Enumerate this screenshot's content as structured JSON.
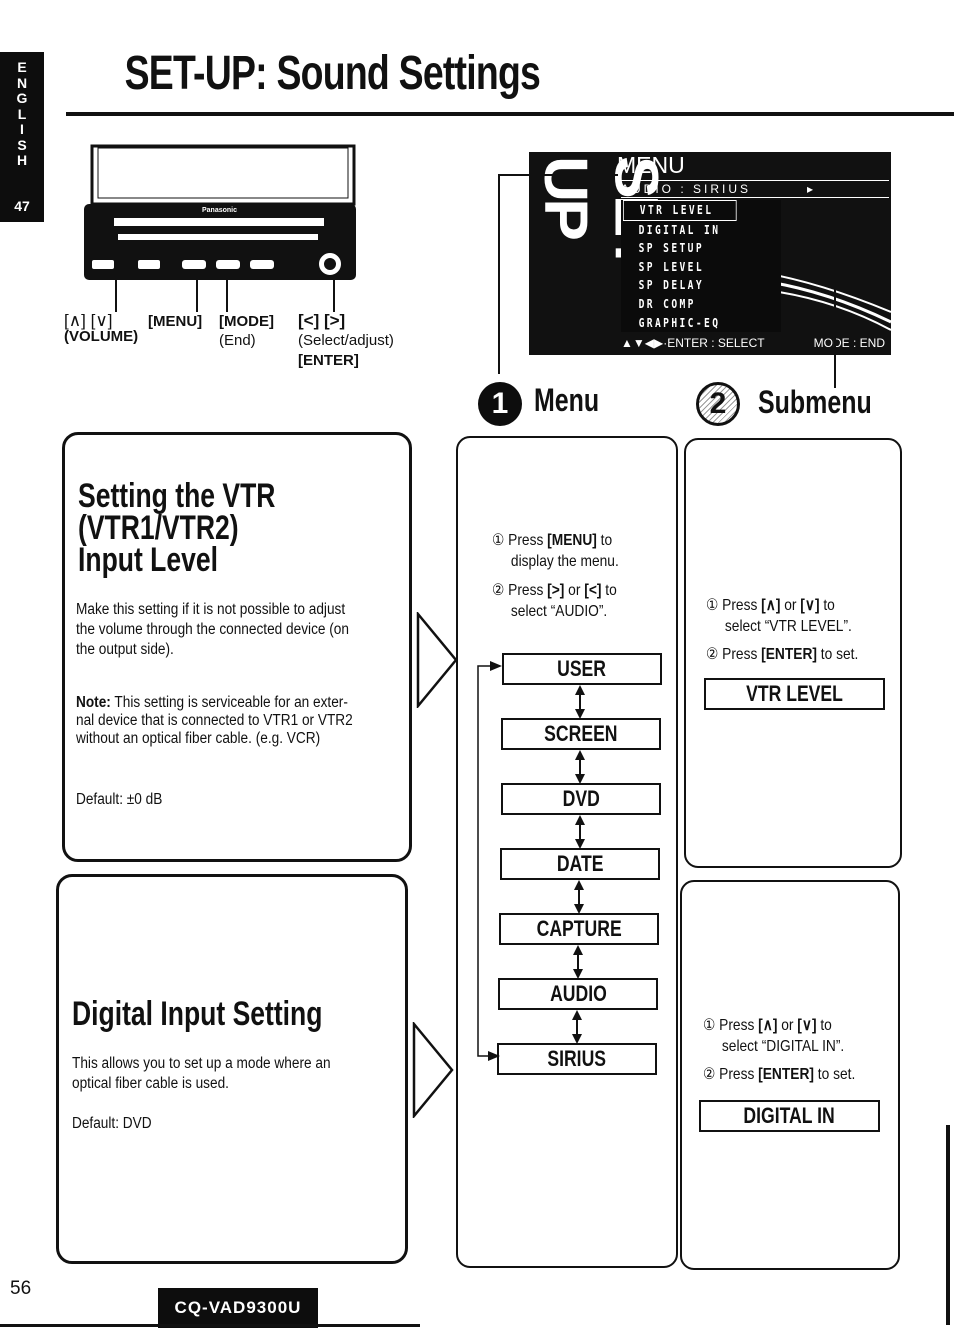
{
  "side_tab": {
    "letters": [
      "E",
      "N",
      "G",
      "L",
      "I",
      "S",
      "H"
    ],
    "chapter": "47"
  },
  "page_title": "SET-UP: Sound Settings",
  "device": {
    "brand": "Panasonic",
    "callouts": {
      "volume_keys": "[∧] [∨]",
      "volume_label": "(VOLUME)",
      "menu_key": "[MENU]",
      "mode_key": "[MODE]",
      "mode_label": "(End)",
      "select_keys": "[<] [>]",
      "select_label": "(Select/adjust)",
      "enter_key": "[ENTER]"
    }
  },
  "screen": {
    "side_text": "SET-UP",
    "title": "MENU",
    "breadcrumb": "AUDIO : SIRIUS",
    "breadcrumb_arrow": "▸",
    "items": [
      "VTR LEVEL",
      "DIGITAL IN",
      "SP SETUP",
      "SP LEVEL",
      "SP DELAY",
      "DR COMP",
      "GRAPHIC-EQ"
    ],
    "selected_index": 0,
    "footer_left": "▲▼◀▶·ENTER : SELECT",
    "footer_right": "MODE : END"
  },
  "sections": {
    "menu": {
      "number": "1",
      "label": "Menu"
    },
    "submenu": {
      "number": "2",
      "label": "Submenu"
    }
  },
  "vtr_setting": {
    "title_lines": [
      "Setting the VTR",
      "(VTR1/VTR2)",
      "Input Level"
    ],
    "description_lines": [
      "Make this setting if it is not possible to adjust",
      "the volume through the connected device (on",
      "the output side)."
    ],
    "note_label": "Note:",
    "note_lines": [
      " This setting is serviceable for an exter-",
      "nal device that is connected to VTR1 or VTR2",
      "without an optical fiber cable. (e.g. VCR)"
    ],
    "default": "Default: ±0 dB"
  },
  "digital_setting": {
    "title": "Digital Input Setting",
    "description_lines": [
      "This allows you to set up a mode where an",
      "optical fiber cable is used."
    ],
    "default": "Default: DVD"
  },
  "menu_steps": {
    "step1_num": "①",
    "step1_pre": " Press ",
    "step1_key": "[MENU]",
    "step1_post": " to",
    "step1_line2": "display the menu.",
    "step2_num": "②",
    "step2_pre": " Press ",
    "step2_key1": "[>]",
    "step2_mid": " or ",
    "step2_key2": "[<]",
    "step2_post": " to",
    "step2_line2": "select “AUDIO”."
  },
  "menu_chain": [
    "USER",
    "SCREEN",
    "DVD",
    "DATE",
    "CAPTURE",
    "AUDIO",
    "SIRIUS"
  ],
  "submenu_vtr": {
    "step1_num": "①",
    "step1_pre": " Press ",
    "step1_key1": "[∧]",
    "step1_mid": " or ",
    "step1_key2": "[∨]",
    "step1_post": " to",
    "step1_line2": "select “VTR LEVEL”.",
    "step2_num": "②",
    "step2_pre": " Press ",
    "step2_key": "[ENTER]",
    "step2_post": " to set.",
    "result": "VTR LEVEL"
  },
  "submenu_digital": {
    "step1_num": "①",
    "step1_pre": " Press ",
    "step1_key1": "[∧]",
    "step1_mid": " or ",
    "step1_key2": "[∨]",
    "step1_post": " to",
    "step1_line2": "select “DIGITAL IN”.",
    "step2_num": "②",
    "step2_pre": " Press ",
    "step2_key": "[ENTER]",
    "step2_post": " to set.",
    "result": "DIGITAL IN"
  },
  "footer": {
    "page_number": "56",
    "model": "CQ-VAD9300U"
  }
}
